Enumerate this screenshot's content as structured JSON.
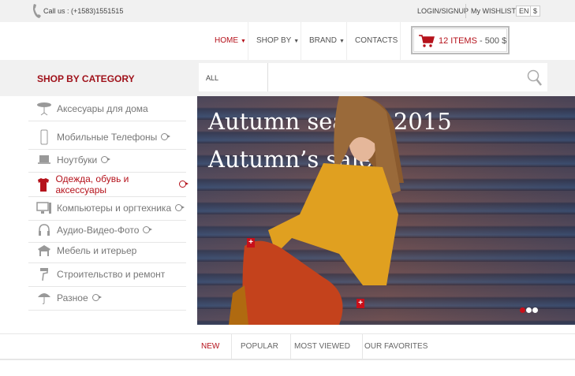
{
  "topbar": {
    "call": "Call us : (+1583)1551515",
    "login": "LOGIN/SIGNUP",
    "wishlist": "My WISHLIST",
    "lang": "EN",
    "currency": "$"
  },
  "nav": {
    "items": [
      {
        "label": "HOME",
        "active": true,
        "dropdown": true
      },
      {
        "label": "SHOP BY",
        "dropdown": true
      },
      {
        "label": "BRAND",
        "dropdown": true
      },
      {
        "label": "CONTACTS"
      }
    ],
    "cart": {
      "items": "12 ITEMS",
      "sep": " - ",
      "total": "500 $",
      "icon": "cart-icon"
    }
  },
  "categorybar": {
    "title": "SHOP BY CATEGORY",
    "select": "ALL CATEGORIES",
    "search_placeholder": "",
    "search_icon": "search-icon"
  },
  "categories": [
    {
      "label": "Аксесуары для дома",
      "icon": "table-icon",
      "sub": false
    },
    {
      "label": "Мобильные Телефоны",
      "icon": "phone-icon",
      "sub": true
    },
    {
      "label": "Ноутбуки",
      "icon": "laptop-icon",
      "sub": true
    },
    {
      "label": "Одежда, обувь и аксессуары",
      "icon": "shirt-icon",
      "sub": true,
      "active": true
    },
    {
      "label": "Компьютеры и оргтехника",
      "icon": "desktop-icon",
      "sub": true
    },
    {
      "label": "Аудио-Видео-Фото",
      "icon": "headphones-icon",
      "sub": true
    },
    {
      "label": "Мебель и итерьер",
      "icon": "furniture-icon",
      "sub": false
    },
    {
      "label": "Строительство и ремонт",
      "icon": "paint-roller-icon",
      "sub": false
    },
    {
      "label": "Разное",
      "icon": "umbrella-icon",
      "sub": true
    }
  ],
  "hero": {
    "line1": "Autumn season 2015",
    "line2": "Autumn’s sale",
    "slides": 3,
    "active_slide": 1
  },
  "tabs": [
    {
      "label": "NEW",
      "active": true
    },
    {
      "label": "POPULAR"
    },
    {
      "label": "MOST VIEWED"
    },
    {
      "label": "OUR FAVORITES"
    }
  ],
  "colors": {
    "accent": "#b5121b",
    "bar": "#f1f1f1"
  }
}
